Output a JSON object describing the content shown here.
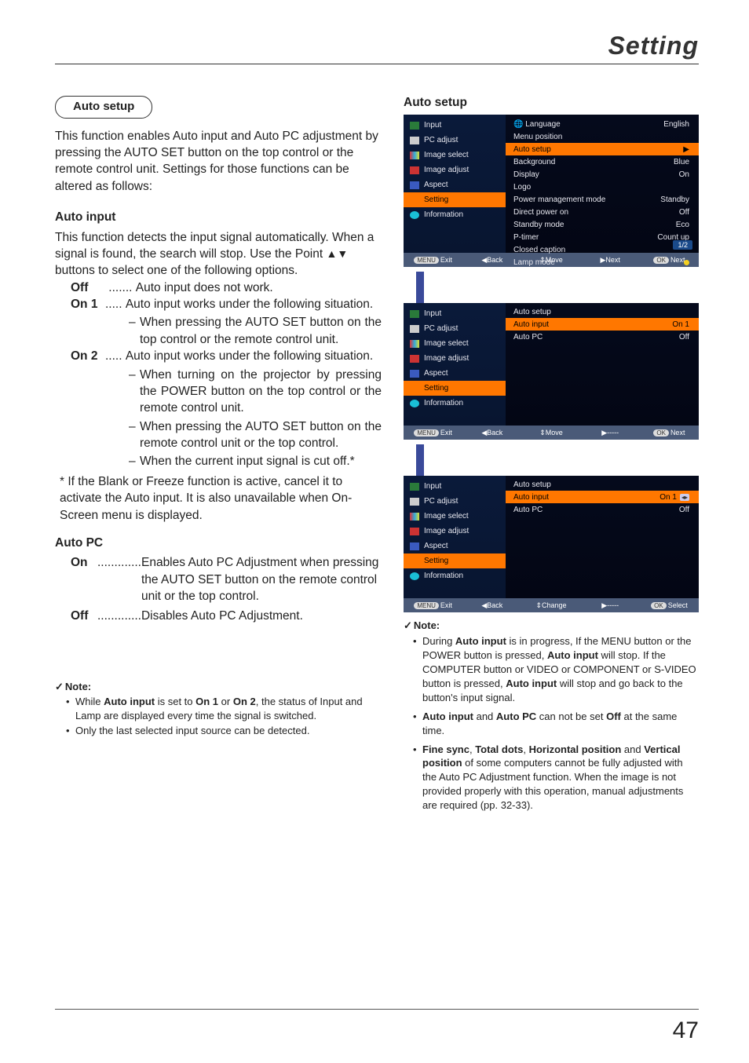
{
  "header": {
    "title": "Setting"
  },
  "page_number": "47",
  "left": {
    "pill": "Auto setup",
    "intro": "This function enables Auto input and Auto PC adjustment by pressing the AUTO SET button on the top control or the remote control unit. Settings for those functions can be altered as follows:",
    "auto_input": {
      "heading": "Auto input",
      "desc1": "This function detects the input signal automatically. When a signal is found, the search will stop. Use the Point ",
      "desc2": " buttons to select one of the following options.",
      "arrows": "▲▼",
      "off_label": "Off",
      "off_dots": " ....... ",
      "off_text": "Auto input does not work.",
      "on1_label": "On 1",
      "on1_dots": "..... ",
      "on1_text": "Auto input works under the following situation.",
      "on1_s1": "When pressing the AUTO SET button on the top control or the remote control unit.",
      "on2_label": "On 2",
      "on2_dots": "..... ",
      "on2_text": "Auto input works under the following situation.",
      "on2_s1": "When turning on the projector by pressing the POWER button on the top control or the remote control unit.",
      "on2_s2": "When pressing the AUTO SET button on the remote control unit or the top control.",
      "on2_s3": " When the current input signal is cut off.*",
      "footnote": "* If the Blank or Freeze function is active, cancel it to activate the Auto input. It is also unavailable when On-Screen menu is displayed."
    },
    "auto_pc": {
      "heading": "Auto PC",
      "on_label": "On",
      "on_dots": ".............",
      "on_text": "Enables Auto PC Adjustment when pressing the AUTO SET button on the remote control unit or the top control.",
      "off_label": "Off",
      "off_dots": ".............",
      "off_text": "Disables Auto PC Adjustment."
    },
    "note": {
      "head": "Note:",
      "i1a": "While ",
      "i1b": "Auto input",
      "i1c": " is set to ",
      "i1d": "On 1",
      "i1e": " or ",
      "i1f": "On 2",
      "i1g": ", the status of Input and Lamp are displayed every time the signal is switched.",
      "i2": "Only the last selected input source can be detected."
    }
  },
  "right": {
    "heading": "Auto setup",
    "menu_items": [
      "Input",
      "PC adjust",
      "Image select",
      "Image adjust",
      "Aspect",
      "Setting",
      "Information"
    ],
    "osd1": {
      "rows": [
        [
          "Language",
          "English"
        ],
        [
          "Menu position",
          ""
        ],
        [
          "Auto setup",
          ""
        ],
        [
          "Background",
          "Blue"
        ],
        [
          "Display",
          "On"
        ],
        [
          "Logo",
          ""
        ],
        [
          "Power management mode",
          "Standby"
        ],
        [
          "Direct power on",
          "Off"
        ],
        [
          "Standby mode",
          "Eco"
        ],
        [
          "P-timer",
          "Count up"
        ],
        [
          "Closed caption",
          ""
        ],
        [
          "Lamp mode",
          ""
        ]
      ],
      "badge": "1/2",
      "lang_icon": "🌐",
      "foot": {
        "exit": "Exit",
        "back": "Back",
        "move": "Move",
        "next": "Next",
        "ok": "Next"
      }
    },
    "osd2": {
      "title": "Auto setup",
      "rows": [
        [
          "Auto input",
          "On 1"
        ],
        [
          "Auto PC",
          "Off"
        ]
      ],
      "foot": {
        "exit": "Exit",
        "back": "Back",
        "move": "Move",
        "next": "-----",
        "ok": "Next"
      }
    },
    "osd3": {
      "title": "Auto setup",
      "rows": [
        [
          "Auto input",
          "On 1"
        ],
        [
          "Auto PC",
          "Off"
        ]
      ],
      "spin": "◂▸",
      "foot": {
        "exit": "Exit",
        "back": "Back",
        "move": "Change",
        "next": "-----",
        "ok": "Select"
      }
    },
    "note": {
      "head": "Note:",
      "i1a": "During ",
      "i1b": "Auto input",
      "i1c": " is in progress, If the MENU button or the POWER button is pressed, ",
      "i1d": "Auto input",
      "i1e": " will stop. If the COMPUTER button or VIDEO or COMPONENT or S-VIDEO button is pressed, ",
      "i1f": "Auto input",
      "i1g": " will stop and go back to the button's input signal.",
      "i2a": "Auto input",
      "i2b": " and ",
      "i2c": "Auto PC",
      "i2d": " can not be set ",
      "i2e": "Off",
      "i2f": " at the same time.",
      "i3a": "Fine sync",
      "i3b": ", ",
      "i3c": "Total dots",
      "i3d": ", ",
      "i3e": "Horizontal position",
      "i3f": " and ",
      "i3g": "Vertical position",
      "i3h": " of some computers cannot be fully adjusted with the Auto PC Adjustment function. When the image is not provided properly with this operation, manual adjustments are required (pp. 32-33)."
    }
  },
  "keys": {
    "menu": "MENU",
    "ok": "OK",
    "updown": "⇕",
    "left": "◀",
    "right": "▶"
  }
}
